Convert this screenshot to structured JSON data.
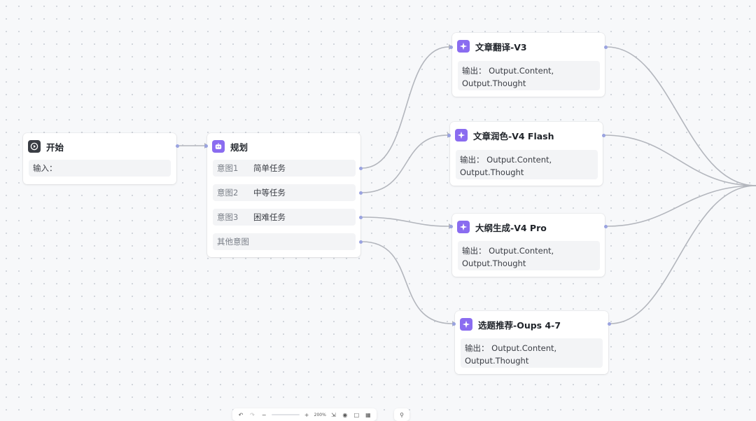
{
  "nodes": {
    "start": {
      "title": "开始",
      "input_label": "输入："
    },
    "planner": {
      "title": "规划",
      "intents": [
        {
          "key": "意图1",
          "value": "简单任务"
        },
        {
          "key": "意图2",
          "value": "中等任务"
        },
        {
          "key": "意图3",
          "value": "困难任务"
        },
        {
          "key": "其他意图",
          "value": ""
        }
      ]
    },
    "translate": {
      "title": "文章翻译-V3",
      "output_line1": "输出：  Output.Content,",
      "output_line2": "Output.Thought"
    },
    "polish": {
      "title": "文章润色-V4 Flash",
      "output_line1": "输出：  Output.Content,",
      "output_line2": "Output.Thought"
    },
    "outline": {
      "title": "大纲生成-V4 Pro",
      "output_line1": "输出：  Output.Content,",
      "output_line2": "Output.Thought"
    },
    "topic": {
      "title": "选题推荐-Oups 4-7",
      "output_line1": "输出：  Output.Content,",
      "output_line2": "Output.Thought"
    }
  },
  "toolbar": {
    "zoom_label": "200%"
  },
  "colors": {
    "edge": "#b3b6bd",
    "handle": "#9aa3e0",
    "accent": "#8a6cf0",
    "canvas": "#f7f8fa"
  },
  "icons": {
    "start": "play-icon",
    "planner": "robot-icon",
    "llm": "sparkle-icon",
    "toolbar": [
      "undo-icon",
      "redo-icon",
      "zoom-out-icon",
      "zoom-in-icon",
      "fit-view-icon",
      "eye-icon",
      "note-icon",
      "grid-icon",
      "bulb-icon"
    ]
  }
}
